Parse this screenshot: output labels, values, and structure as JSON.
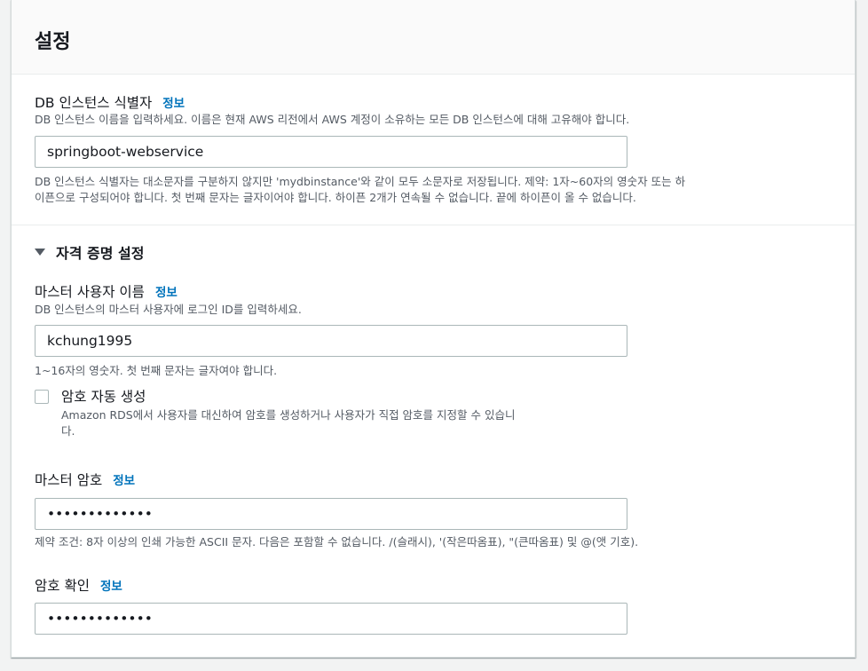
{
  "settings": {
    "title": "설정",
    "info_label": "정보",
    "db_identifier": {
      "label": "DB 인스턴스 식별자",
      "description": "DB 인스턴스 이름을 입력하세요. 이름은 현재 AWS 리전에서 AWS 계정이 소유하는 모든 DB 인스턴스에 대해 고유해야 합니다.",
      "value": "springboot-webservice",
      "constraint_line1": "DB 인스턴스 식별자는 대소문자를 구분하지 않지만 'mydbinstance'와 같이 모두 소문자로 저장됩니다. 제약: 1자~60자의 영숫자 또는 하",
      "constraint_line2": "이픈으로 구성되어야 합니다. 첫 번째 문자는 글자이어야 합니다. 하이픈 2개가 연속될 수 없습니다. 끝에 하이픈이 올 수 없습니다."
    },
    "credentials": {
      "heading": "자격 증명 설정",
      "master_username": {
        "label": "마스터 사용자 이름",
        "description": "DB 인스턴스의 마스터 사용자에 로그인 ID를 입력하세요.",
        "value": "kchung1995",
        "constraint": "1~16자의 영숫자. 첫 번째 문자는 글자여야 합니다."
      },
      "auto_password": {
        "label": "암호 자동 생성",
        "description_line1": "Amazon RDS에서 사용자를 대신하여 암호를 생성하거나 사용자가 직접 암호를 지정할 수 있습니",
        "description_line2": "다.",
        "checked": false
      },
      "master_password": {
        "label": "마스터 암호",
        "value": "•••••••••••••",
        "constraint": "제약 조건: 8자 이상의 인쇄 가능한 ASCII 문자. 다음은 포함할 수 없습니다. /(슬래시), '(작은따옴표), \"(큰따옴표) 및 @(앳 기호)."
      },
      "confirm_password": {
        "label": "암호 확인",
        "value": "•••••••••••••"
      }
    }
  }
}
